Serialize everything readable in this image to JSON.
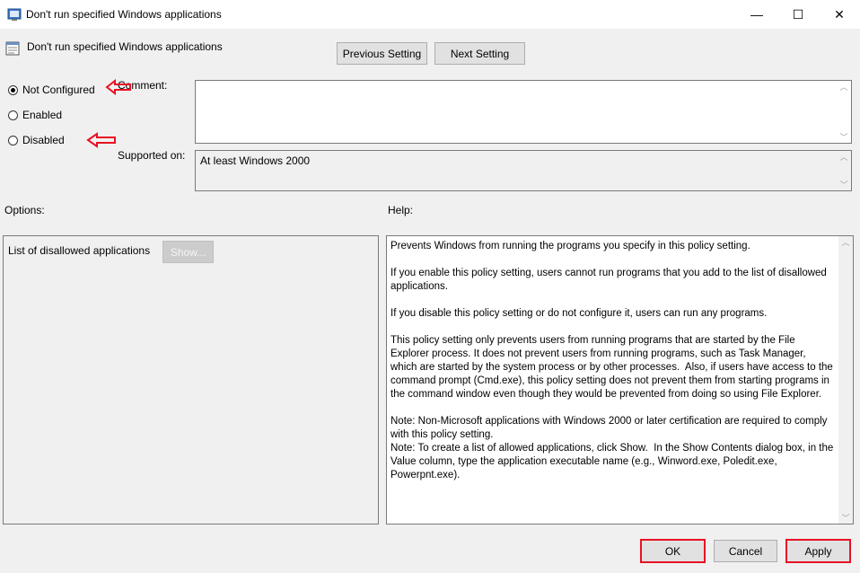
{
  "window": {
    "title": "Don't run specified Windows applications",
    "minimize": "—",
    "maximize": "☐",
    "close": "✕"
  },
  "header": {
    "policy_name": "Don't run specified Windows applications",
    "prev_label": "Previous Setting",
    "next_label": "Next Setting"
  },
  "state": {
    "options": [
      {
        "label": "Not Configured",
        "checked": true
      },
      {
        "label": "Enabled",
        "checked": false
      },
      {
        "label": "Disabled",
        "checked": false
      }
    ]
  },
  "comment": {
    "label": "Comment:",
    "value": ""
  },
  "supported": {
    "label": "Supported on:",
    "value": "At least Windows 2000"
  },
  "options_panel": {
    "label": "Options:",
    "list_label": "List of disallowed applications",
    "show_label": "Show..."
  },
  "help_panel": {
    "label": "Help:",
    "text": "Prevents Windows from running the programs you specify in this policy setting.\n\nIf you enable this policy setting, users cannot run programs that you add to the list of disallowed applications.\n\nIf you disable this policy setting or do not configure it, users can run any programs.\n\nThis policy setting only prevents users from running programs that are started by the File Explorer process. It does not prevent users from running programs, such as Task Manager, which are started by the system process or by other processes.  Also, if users have access to the command prompt (Cmd.exe), this policy setting does not prevent them from starting programs in the command window even though they would be prevented from doing so using File Explorer.\n\nNote: Non-Microsoft applications with Windows 2000 or later certification are required to comply with this policy setting.\nNote: To create a list of allowed applications, click Show.  In the Show Contents dialog box, in the Value column, type the application executable name (e.g., Winword.exe, Poledit.exe, Powerpnt.exe)."
  },
  "footer": {
    "ok_label": "OK",
    "cancel_label": "Cancel",
    "apply_label": "Apply"
  },
  "colors": {
    "annotation": "#e81123",
    "dialog_bg": "#f0f0f0"
  }
}
